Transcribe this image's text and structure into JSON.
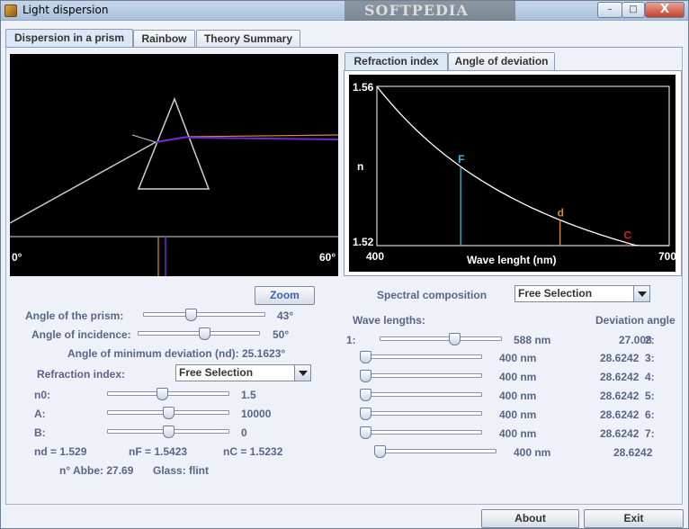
{
  "window": {
    "title": "Light dispersion",
    "watermark": "SOFTPEDIA",
    "min_label": "–",
    "max_label": "□",
    "close_label": "X"
  },
  "tabs": [
    "Dispersion in a prism",
    "Rainbow",
    "Theory Summary"
  ],
  "graph_tabs": [
    "Refraction index",
    "Angle of deviation"
  ],
  "prism_view": {
    "scale_min": "0°",
    "scale_max": "60°"
  },
  "graph": {
    "y_max": "1.56",
    "y_min": "1.52",
    "y_label": "n",
    "x_min": "400",
    "x_max": "700",
    "x_label": "Wave lenght (nm)",
    "lines": [
      {
        "label": "F",
        "wavelength": 486,
        "color": "#3fb8d8"
      },
      {
        "label": "d",
        "wavelength": 588,
        "color": "#e08a2a"
      },
      {
        "label": "C",
        "wavelength": 656,
        "color": "#d02020"
      }
    ]
  },
  "left": {
    "zoom_label": "Zoom",
    "prism_angle_label": "Angle of the prism:",
    "prism_angle_value": "43°",
    "prism_angle_level": 0.38,
    "incidence_label": "Angle of incidence:",
    "incidence_value": "50°",
    "incidence_level": 0.55,
    "min_dev": "Angle of minimum deviation (nd): 25.1623°",
    "ri_label": "Refraction index:",
    "ri_selected": "Free Selection",
    "params": [
      {
        "label": "n0:",
        "value": "1.5",
        "level": 0.45
      },
      {
        "label": "A:",
        "value": "10000",
        "level": 0.5
      },
      {
        "label": "B:",
        "value": "0",
        "level": 0.5
      }
    ],
    "nd": "nd = 1.529",
    "nF": "nF = 1.5423",
    "nC": "nC = 1.5232",
    "abbe": "n° Abbe: 27.69",
    "glass": "Glass: flint"
  },
  "right": {
    "spectral_label": "Spectral composition",
    "spectral_selected": "Free Selection",
    "wl_header": "Wave lengths:",
    "dev_header": "Deviation angle",
    "rows": [
      {
        "index": "1:",
        "wl": "588 nm",
        "dev": "27.008",
        "level": 0.63
      },
      {
        "index": "2:",
        "wl": "400 nm",
        "dev": "28.6242",
        "level": 0.0
      },
      {
        "index": "3:",
        "wl": "400 nm",
        "dev": "28.6242",
        "level": 0.0
      },
      {
        "index": "4:",
        "wl": "400 nm",
        "dev": "28.6242",
        "level": 0.0
      },
      {
        "index": "5:",
        "wl": "400 nm",
        "dev": "28.6242",
        "level": 0.0
      },
      {
        "index": "6:",
        "wl": "400 nm",
        "dev": "28.6242",
        "level": 0.0
      },
      {
        "index": "7:",
        "wl": "400 nm",
        "dev": "28.6242",
        "level": 0.0
      }
    ]
  },
  "footer": {
    "about": "About",
    "exit": "Exit"
  }
}
